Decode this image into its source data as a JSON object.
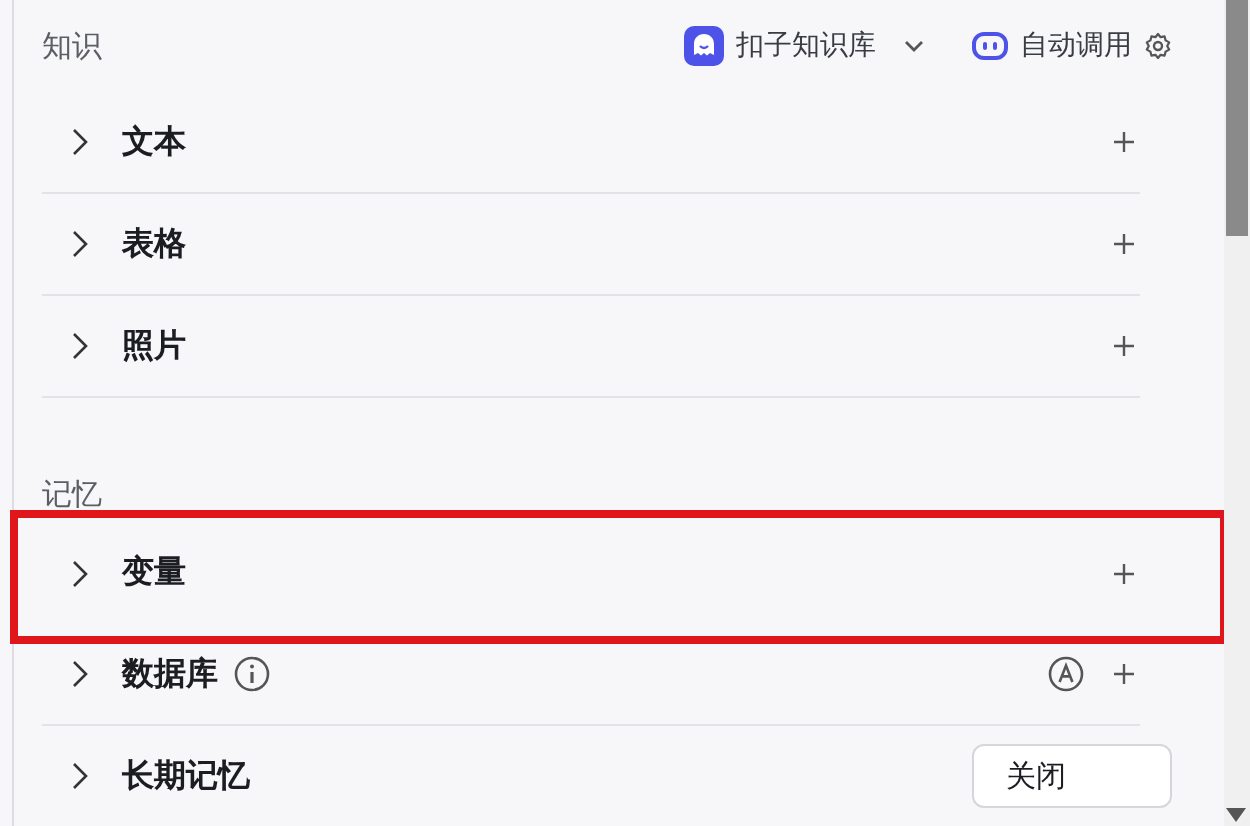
{
  "sections": [
    {
      "title": "知识",
      "source": {
        "label": "扣子知识库"
      },
      "mode": {
        "label": "自动调用"
      },
      "items": [
        {
          "label": "文本",
          "expanded": false,
          "info": false,
          "auto": false,
          "highlighted": false
        },
        {
          "label": "表格",
          "expanded": false,
          "info": false,
          "auto": false,
          "highlighted": false
        },
        {
          "label": "照片",
          "expanded": false,
          "info": false,
          "auto": false,
          "highlighted": false
        }
      ]
    },
    {
      "title": "记忆",
      "items": [
        {
          "label": "变量",
          "expanded": false,
          "info": false,
          "auto": false,
          "highlighted": true
        },
        {
          "label": "数据库",
          "expanded": false,
          "info": true,
          "auto": true,
          "highlighted": false
        },
        {
          "label": "长期记忆",
          "expanded": false,
          "info": false,
          "auto": false,
          "highlighted": false,
          "select": {
            "value": "关闭"
          }
        }
      ]
    }
  ]
}
